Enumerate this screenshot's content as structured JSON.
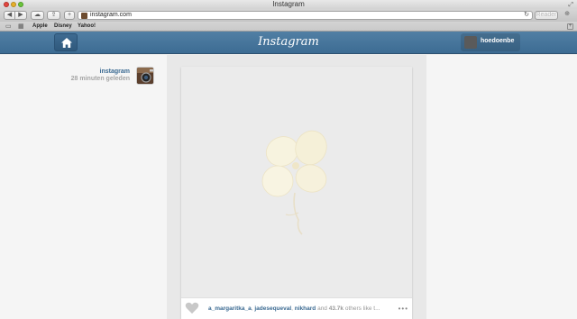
{
  "window": {
    "title": "Instagram"
  },
  "toolbar": {
    "back_icon": "◀",
    "forward_icon": "▶",
    "url": "instagram.com",
    "reader_label": "Reader"
  },
  "bookmarks": {
    "items": [
      "Apple",
      "Disney",
      "Yahoo!"
    ]
  },
  "header": {
    "logo": "Instagram",
    "username": "hoedoenbe"
  },
  "post": {
    "author": "instagram",
    "time": "28 minuten geleden",
    "likers": [
      "a_margaritka_a",
      "jadesequeval",
      "nikhard"
    ],
    "and_text": "and",
    "like_count": "43.7k",
    "others_text": "others like t...",
    "more": "•••"
  },
  "colors": {
    "header_blue": "#3d6c93",
    "link_blue": "#3b6a92"
  }
}
